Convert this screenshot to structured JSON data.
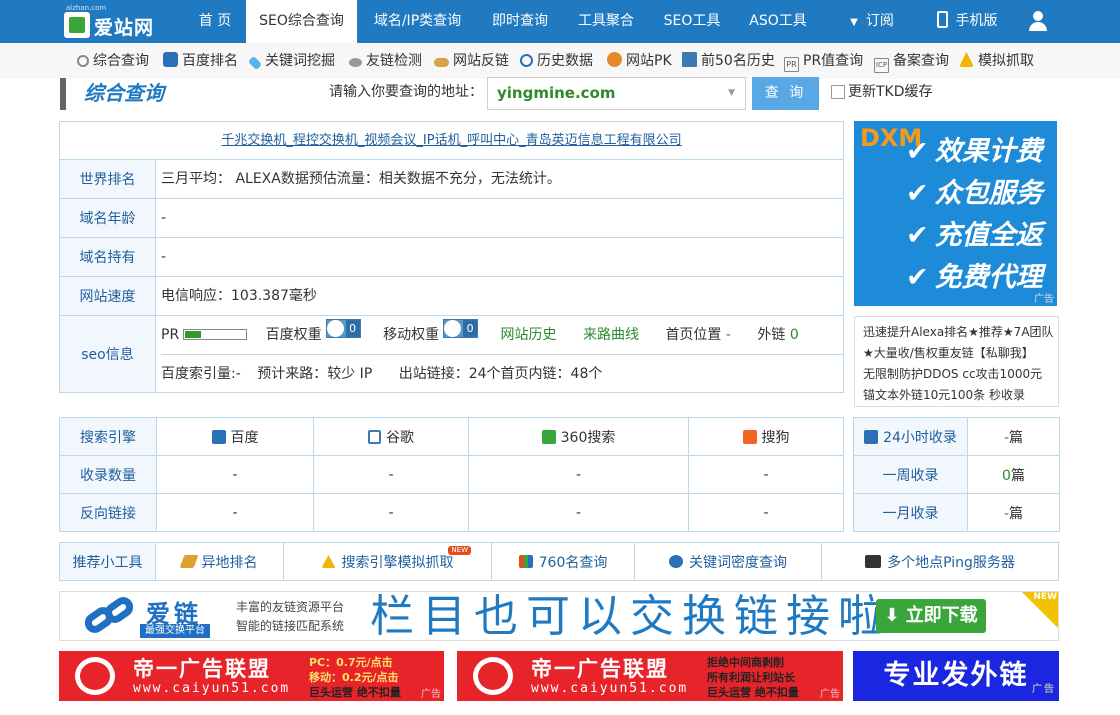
{
  "logo": {
    "domain": "aizhan.com",
    "name": "爱站网"
  },
  "nav": {
    "home": "首 页",
    "seo": "SEO综合查询",
    "domain": "域名/IP类查询",
    "instant": "即时查询",
    "tools": "工具聚合",
    "seotools": "SEO工具",
    "aso": "ASO工具",
    "subscribe": "订阅",
    "mobile": "手机版"
  },
  "subnav": [
    "综合查询",
    "百度排名",
    "关键词挖掘",
    "友链检测",
    "网站反链",
    "历史数据",
    "网站PK",
    "前50名历史",
    "PR值查询",
    "备案查询",
    "模拟抓取"
  ],
  "query": {
    "title": "综合查询",
    "label": "请输入你要查询的地址：",
    "value": "yingmine.com",
    "button": "查 询",
    "checkbox": "更新TKD缓存"
  },
  "site": {
    "title": "千兆交换机_程控交换机_视频会议_IP话机_呼叫中心_青岛英迈信息工程有限公司",
    "rank_label": "世界排名",
    "rank_value": "三月平均： ALEXA数据预估流量：相关数据不充分，无法统计。",
    "age_label": "域名年龄",
    "age_value": "-",
    "owner_label": "域名持有",
    "owner_value": "-",
    "speed_label": "网站速度",
    "speed_value": "电信响应：103.387毫秒",
    "seo_label": "seo信息",
    "pr": "PR",
    "baidu_weight": "百度权重",
    "baidu_weight_num": "0",
    "mobile_weight": "移动权重",
    "mobile_weight_num": "0",
    "history": "网站历史",
    "route": "来路曲线",
    "home_pos_label": "首页位置",
    "home_pos_value": "-",
    "external_label": "外链",
    "external_value": "0",
    "index_label": "百度索引量:",
    "index_value": "-",
    "traffic_label": "预计来路：",
    "traffic_value": "较少 IP",
    "links": "出站链接：24个首页内链：48个"
  },
  "ad_right": {
    "side": "DXM",
    "lines": [
      "效果计费",
      "众包服务",
      "充值全返",
      "免费代理"
    ],
    "tag": "广告"
  },
  "ad_text": [
    "迅速提升Alexa排名★推荐★7A团队",
    "★大量收/售权重友链【私聊我】",
    "无限制防护DDOS cc攻击1000元",
    "锚文本外链10元100条 秒收录"
  ],
  "engines": {
    "label_engine": "搜索引擎",
    "label_index": "收录数量",
    "label_back": "反向链接",
    "names": [
      "百度",
      "谷歌",
      "360搜索",
      "搜狗"
    ],
    "index": [
      "-",
      "-",
      "-",
      "-"
    ],
    "back": [
      "-",
      "-",
      "-",
      "-"
    ]
  },
  "collect": {
    "h24_label": "24小时收录",
    "h24_value": "-",
    "week_label": "一周收录",
    "week_value": "0",
    "month_label": "一月收录",
    "month_value": "-",
    "unit": "篇"
  },
  "tools": {
    "label": "推荐小工具",
    "items": [
      "异地排名",
      "搜索引擎模拟抓取",
      "760名查询",
      "关键词密度查询",
      "多个地点Ping服务器"
    ],
    "new_tag": "NEW"
  },
  "banner": {
    "name": "爱链",
    "sub": "最强交换平台",
    "desc1": "丰富的友链资源平台",
    "desc2": "智能的链接匹配系统",
    "headline": "栏目也可以交换链接啦!",
    "button": "立即下载",
    "new": "NEW"
  },
  "bottom_ads": {
    "brand": "帝一广告联盟",
    "url": "www.caiyun51.com",
    "a1_l1": "PC：0.7元/点击",
    "a1_l2": "移动：0.2元/点击",
    "a1_l3": "巨头运营 绝不扣量",
    "a2_l1": "拒绝中间商剥削",
    "a2_l2": "所有利润让利站长",
    "a2_l3": "巨头运营 绝不扣量",
    "a3": "专业发外链",
    "tag": "广告"
  },
  "colors": {
    "nav": "#1f7ac2",
    "accent": "#59a8e6",
    "green": "#2d8a2d",
    "border": "#bcd9ec",
    "ad_red": "#e8242b",
    "ad_blue": "#1a26e0"
  }
}
